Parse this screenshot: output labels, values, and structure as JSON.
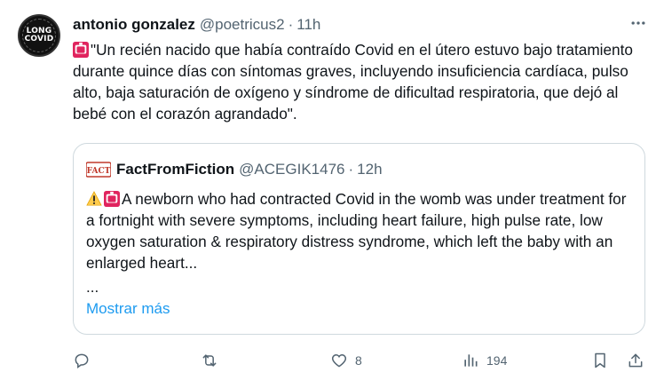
{
  "tweet": {
    "author_name": "antonio gonzalez",
    "author_handle": "@poetricus2",
    "separator": "·",
    "time": "11h",
    "avatar_text_top": "LONG",
    "avatar_text_bottom": "COVID",
    "text": "\"Un recién nacido que había contraído Covid en el útero estuvo bajo tratamiento durante quince días con síntomas graves, incluyendo insuficiencia cardíaca, pulso alto, baja saturación de oxígeno y síndrome de dificultad respiratoria, que dejó al bebé con el corazón agrandado\"."
  },
  "quote": {
    "author_name": "FactFromFiction",
    "author_handle": "@ACEGIK1476",
    "separator": "·",
    "time": "12h",
    "logo_text": "FACT",
    "text": "A newborn who had contracted Covid in the womb was under treatment for a fortnight with severe symptoms, including heart failure, high pulse rate, low oxygen saturation & respiratory distress syndrome, which left the baby with an enlarged heart...",
    "ellipsis": "...",
    "show_more": "Mostrar más"
  },
  "actions": {
    "likes": "8",
    "views": "194"
  },
  "colors": {
    "text": "#0f1419",
    "muted": "#536471",
    "link": "#1d9bf0",
    "border": "#cfd9de",
    "alert_red": "#e0245e"
  },
  "icons": [
    "rotating-light-icon",
    "warning-icon",
    "more-icon",
    "reply-icon",
    "retweet-icon",
    "like-icon",
    "views-icon",
    "bookmark-icon",
    "share-icon"
  ]
}
